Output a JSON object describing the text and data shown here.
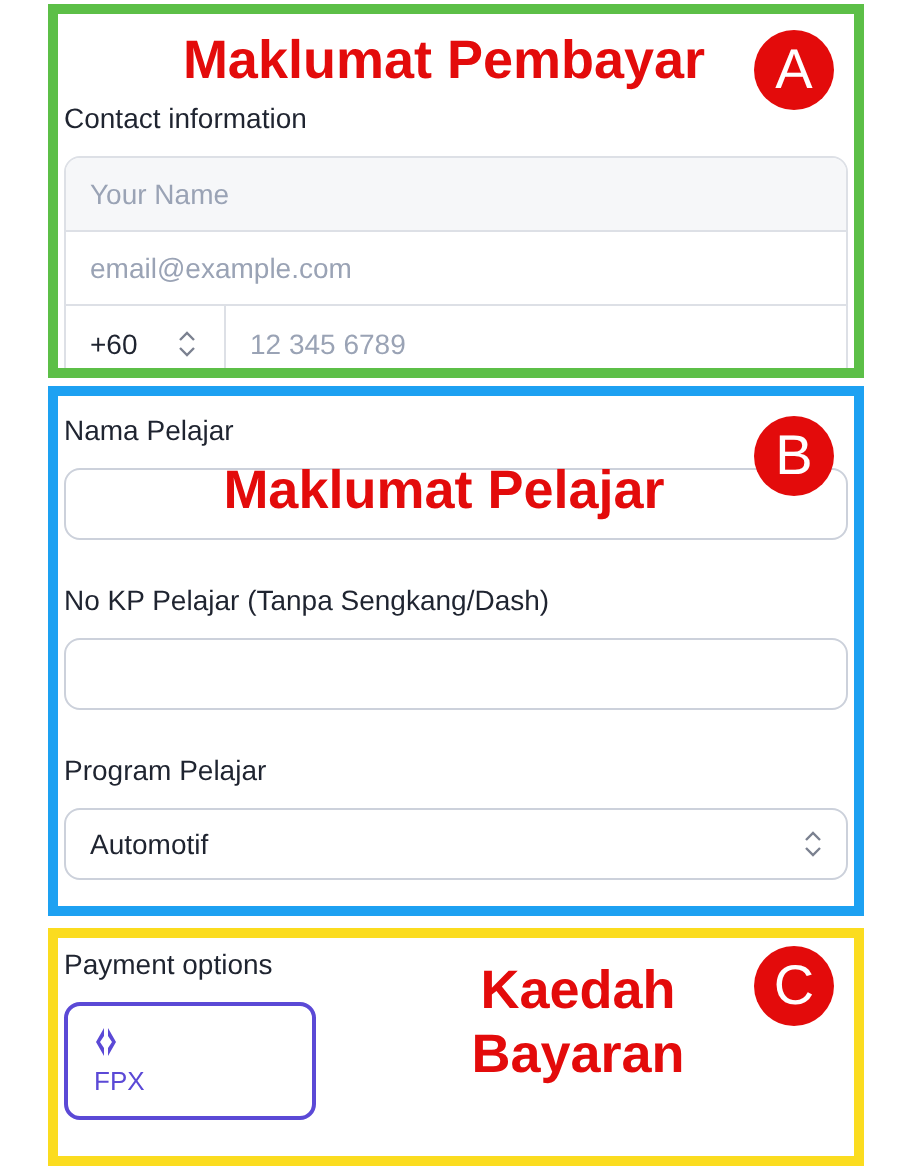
{
  "payer_section": {
    "color": "#5cbf47",
    "annotation": "Maklumat Pembayar",
    "badge": "A",
    "label": "Contact information",
    "name_placeholder": "Your Name",
    "email_placeholder": "email@example.com",
    "country_code": "+60",
    "phone_placeholder": "12 345 6789"
  },
  "student_section": {
    "color": "#1da1f2",
    "annotation": "Maklumat Pelajar",
    "badge": "B",
    "fields": [
      {
        "kind": "text",
        "label": "Nama Pelajar"
      },
      {
        "kind": "text",
        "label": "No KP Pelajar (Tanpa Sengkang/Dash)"
      },
      {
        "kind": "select",
        "label": "Program Pelajar",
        "value": "Automotif"
      }
    ]
  },
  "payment_section": {
    "color": "#fbdc1f",
    "annotation": "Kaedah Bayaran",
    "badge": "C",
    "label": "Payment options",
    "options": [
      {
        "label": "FPX",
        "selected": true
      }
    ]
  }
}
